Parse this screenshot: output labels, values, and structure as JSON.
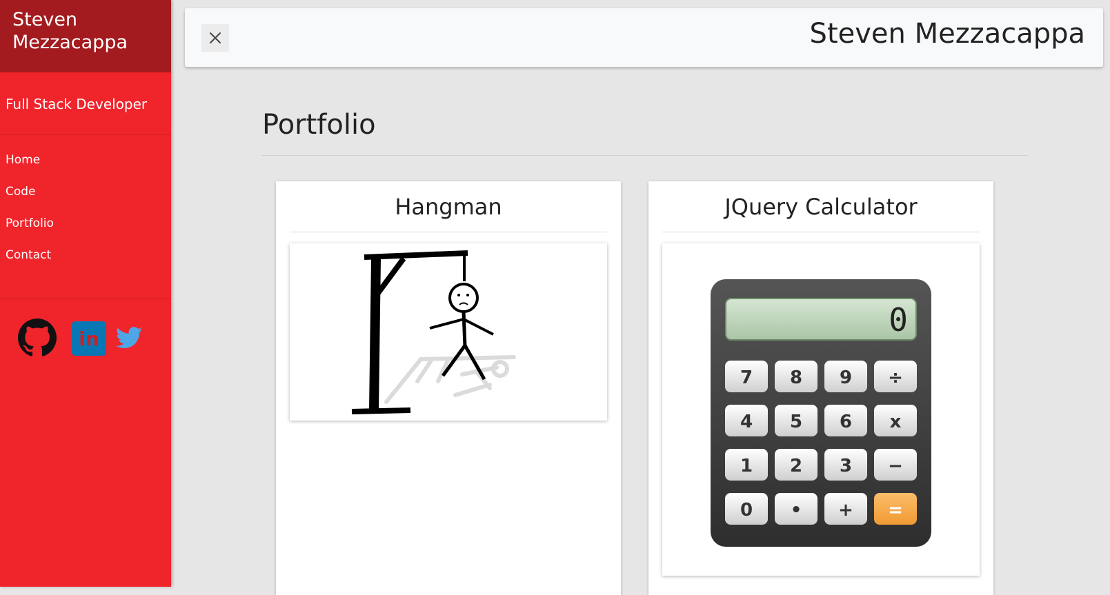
{
  "sidebar": {
    "brand_line1": "Steven",
    "brand_line2": "Mezzacappa",
    "tagline": "Full Stack Developer",
    "nav": [
      {
        "label": "Home"
      },
      {
        "label": "Code"
      },
      {
        "label": "Portfolio"
      },
      {
        "label": "Contact"
      }
    ],
    "social_icons": [
      "github-icon",
      "linkedin-icon",
      "twitter-icon"
    ],
    "linkedin_text": "in"
  },
  "topbar": {
    "title": "Steven Mezzacappa",
    "close_icon": "close-icon"
  },
  "main": {
    "page_title": "Portfolio",
    "cards": [
      {
        "title": "Hangman"
      },
      {
        "title": "JQuery Calculator"
      }
    ]
  },
  "calculator_image": {
    "display": "0",
    "keys": [
      "7",
      "8",
      "9",
      "÷",
      "4",
      "5",
      "6",
      "x",
      "1",
      "2",
      "3",
      "−",
      "0",
      "•",
      "+",
      "="
    ]
  },
  "colors": {
    "sidebar": "#f0242b",
    "brand_header": "#a31b1f",
    "linkedin": "#0a77b5",
    "twitter": "#4fa6e6",
    "equals_key": "#f7a446"
  }
}
